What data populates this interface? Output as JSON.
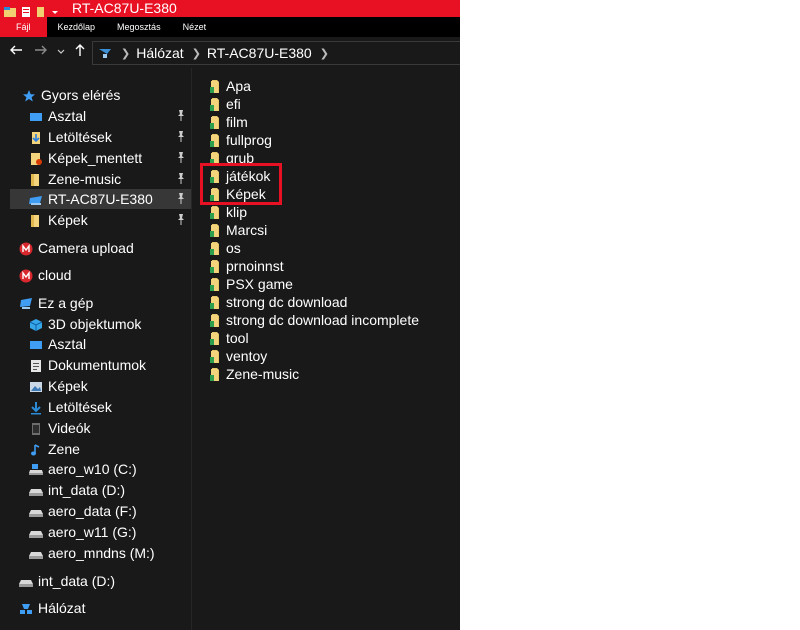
{
  "window": {
    "title": "RT-AC87U-E380",
    "accent_color": "#e81123"
  },
  "ribbon": {
    "tabs": [
      "Fájl",
      "Kezdőlap",
      "Megosztás",
      "Nézet"
    ]
  },
  "navigation": {
    "back_icon": "arrow-left-icon",
    "forward_icon": "arrow-right-icon",
    "recent_icon": "chevron-down-icon",
    "up_icon": "arrow-up-icon",
    "breadcrumbs": [
      "Hálózat",
      "RT-AC87U-E380"
    ]
  },
  "sidebar": {
    "quick_access": {
      "label": "Gyors elérés",
      "items": [
        {
          "label": "Asztal",
          "icon": "desktop-icon",
          "pinned": true
        },
        {
          "label": "Letöltések",
          "icon": "download-icon",
          "pinned": true
        },
        {
          "label": "Képek_mentett",
          "icon": "folder-icon",
          "pinned": true
        },
        {
          "label": "Zene-music",
          "icon": "folder-icon",
          "pinned": true
        },
        {
          "label": "RT-AC87U-E380",
          "icon": "network-drive-icon",
          "pinned": true,
          "selected": true
        },
        {
          "label": "Képek",
          "icon": "folder-icon",
          "pinned": true
        }
      ]
    },
    "camera_upload": "Camera upload",
    "cloud": "cloud",
    "this_pc": {
      "label": "Ez a gép",
      "items": [
        {
          "label": "3D objektumok",
          "icon": "cube-icon"
        },
        {
          "label": "Asztal",
          "icon": "desktop-icon"
        },
        {
          "label": "Dokumentumok",
          "icon": "document-icon"
        },
        {
          "label": "Képek",
          "icon": "picture-icon"
        },
        {
          "label": "Letöltések",
          "icon": "download-icon"
        },
        {
          "label": "Videók",
          "icon": "video-icon"
        },
        {
          "label": "Zene",
          "icon": "music-icon"
        },
        {
          "label": "aero_w10 (C:)",
          "icon": "system-drive-icon"
        },
        {
          "label": "int_data (D:)",
          "icon": "drive-icon"
        },
        {
          "label": "aero_data (F:)",
          "icon": "drive-icon"
        },
        {
          "label": "aero_w11 (G:)",
          "icon": "drive-icon"
        },
        {
          "label": "aero_mndns (M:)",
          "icon": "drive-icon"
        }
      ]
    },
    "external_drive": "int_data (D:)",
    "network": "Hálózat"
  },
  "content": {
    "folders": [
      "Apa",
      "efi",
      "film",
      "fullprog",
      "grub",
      "játékok",
      "Képek",
      "klip",
      "Marcsi",
      "os",
      "prnoinnst",
      "PSX game",
      "strong dc download",
      "strong dc download incomplete",
      "tool",
      "ventoy",
      "Zene-music"
    ],
    "highlighted_folders": [
      "játékok",
      "Képek"
    ],
    "highlight_color": "#e81123"
  }
}
